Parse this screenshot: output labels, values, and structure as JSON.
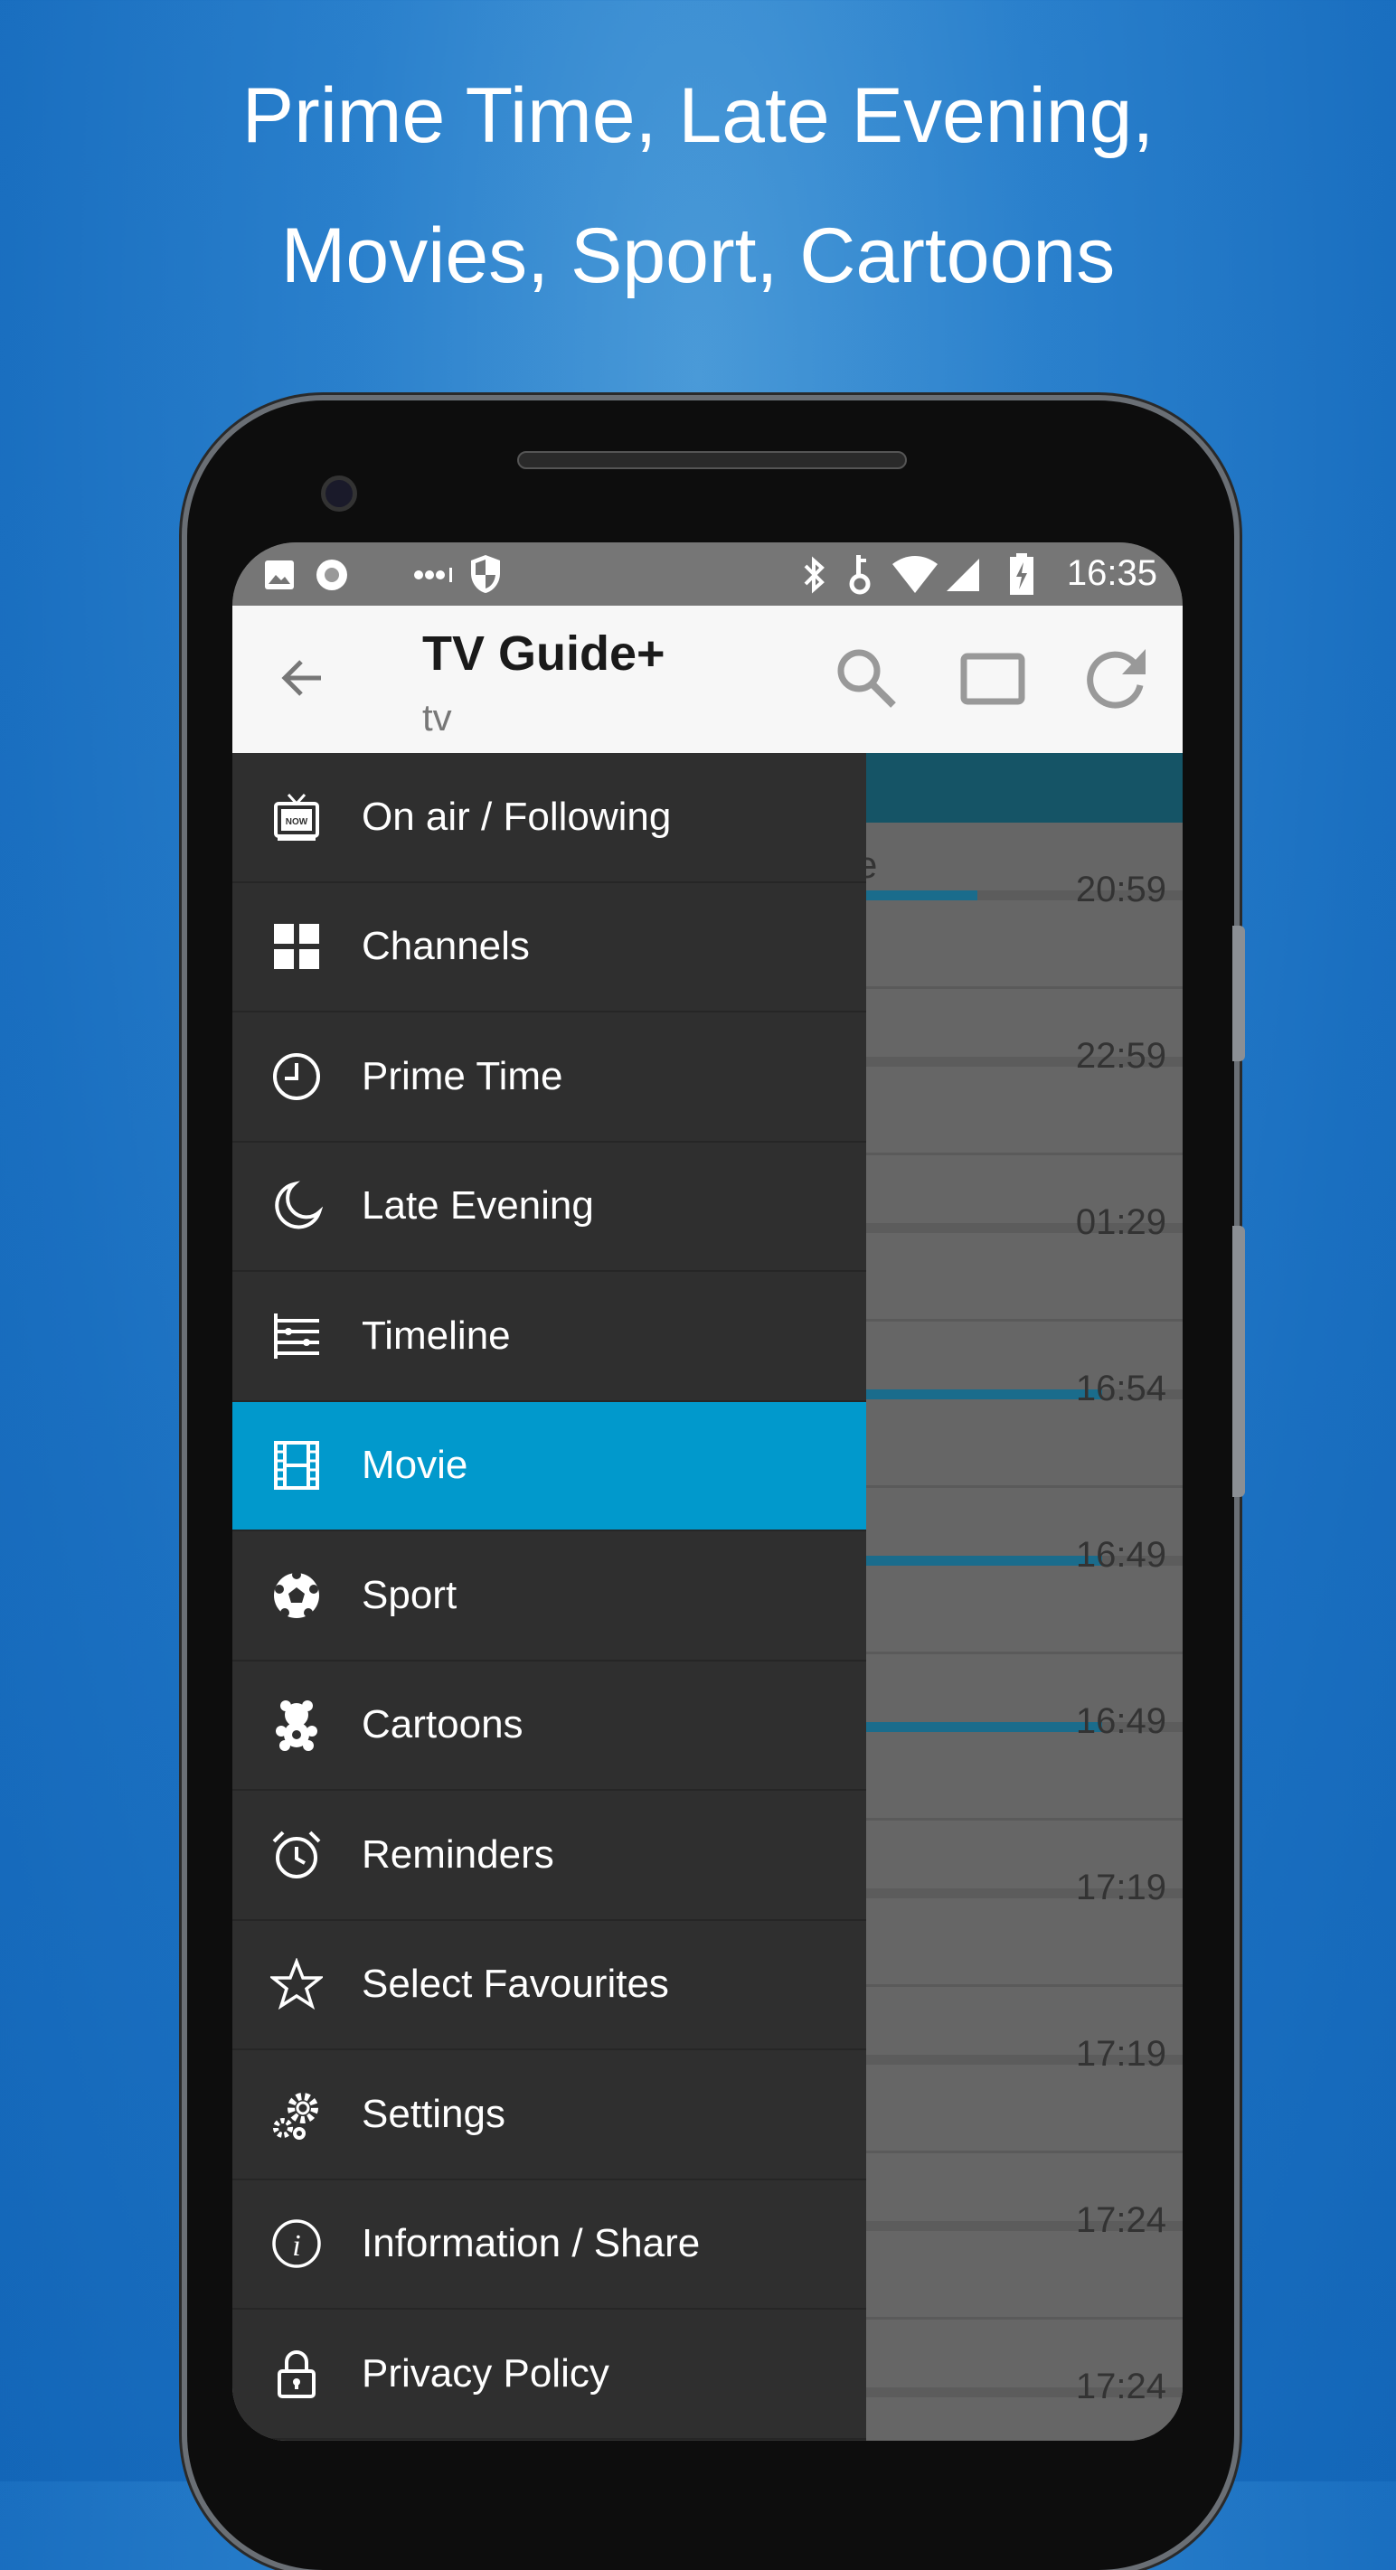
{
  "headline": {
    "line1": "Prime Time, Late Evening,",
    "line2": "Movies, Sport, Cartoons"
  },
  "status_bar": {
    "time": "16:35",
    "icons": [
      "image-icon",
      "circle-icon",
      "dots-icon",
      "shield-icon",
      "bluetooth-icon",
      "key-icon",
      "wifi-icon",
      "signal-icon",
      "battery-charging-icon"
    ]
  },
  "app_bar": {
    "title": "TV Guide+",
    "subtitle": "tv",
    "icons": [
      "back-arrow-icon",
      "search-icon",
      "rectangle-icon",
      "refresh-icon"
    ]
  },
  "colors": {
    "accent": "#0199cc",
    "drawer": "#2f2f2f",
    "progress": "#1a6c8c"
  },
  "drawer": {
    "items": [
      {
        "label": "On air / Following",
        "icon": "tv-now-icon",
        "active": false
      },
      {
        "label": "Channels",
        "icon": "grid-icon",
        "active": false
      },
      {
        "label": "Prime Time",
        "icon": "clock-icon",
        "active": false
      },
      {
        "label": "Late Evening",
        "icon": "moon-icon",
        "active": false
      },
      {
        "label": "Timeline",
        "icon": "timeline-icon",
        "active": false
      },
      {
        "label": "Movie",
        "icon": "film-icon",
        "active": true
      },
      {
        "label": "Sport",
        "icon": "soccer-ball-icon",
        "active": false
      },
      {
        "label": "Cartoons",
        "icon": "teddy-bear-icon",
        "active": false
      },
      {
        "label": "Reminders",
        "icon": "alarm-clock-icon",
        "active": false
      },
      {
        "label": "Select Favourites",
        "icon": "star-icon",
        "active": false
      },
      {
        "label": "Settings",
        "icon": "gears-icon",
        "active": false
      },
      {
        "label": "Information / Share",
        "icon": "info-icon",
        "active": false
      },
      {
        "label": "Privacy Policy",
        "icon": "lock-icon",
        "active": false
      }
    ]
  },
  "list": {
    "first_title_fragment": "e",
    "rows": [
      {
        "time": "20:59",
        "progress": 0.27
      },
      {
        "time": "22:59",
        "progress": 0
      },
      {
        "time": "01:29",
        "progress": 0
      },
      {
        "time": "16:54",
        "progress": 0.57
      },
      {
        "time": "16:49",
        "progress": 0.57
      },
      {
        "time": "16:49",
        "progress": 0.57
      },
      {
        "time": "17:19",
        "progress": 0
      },
      {
        "time": "17:19",
        "progress": 0
      },
      {
        "time": "17:24",
        "progress": 0
      },
      {
        "time": "17:24",
        "progress": 0
      }
    ]
  }
}
